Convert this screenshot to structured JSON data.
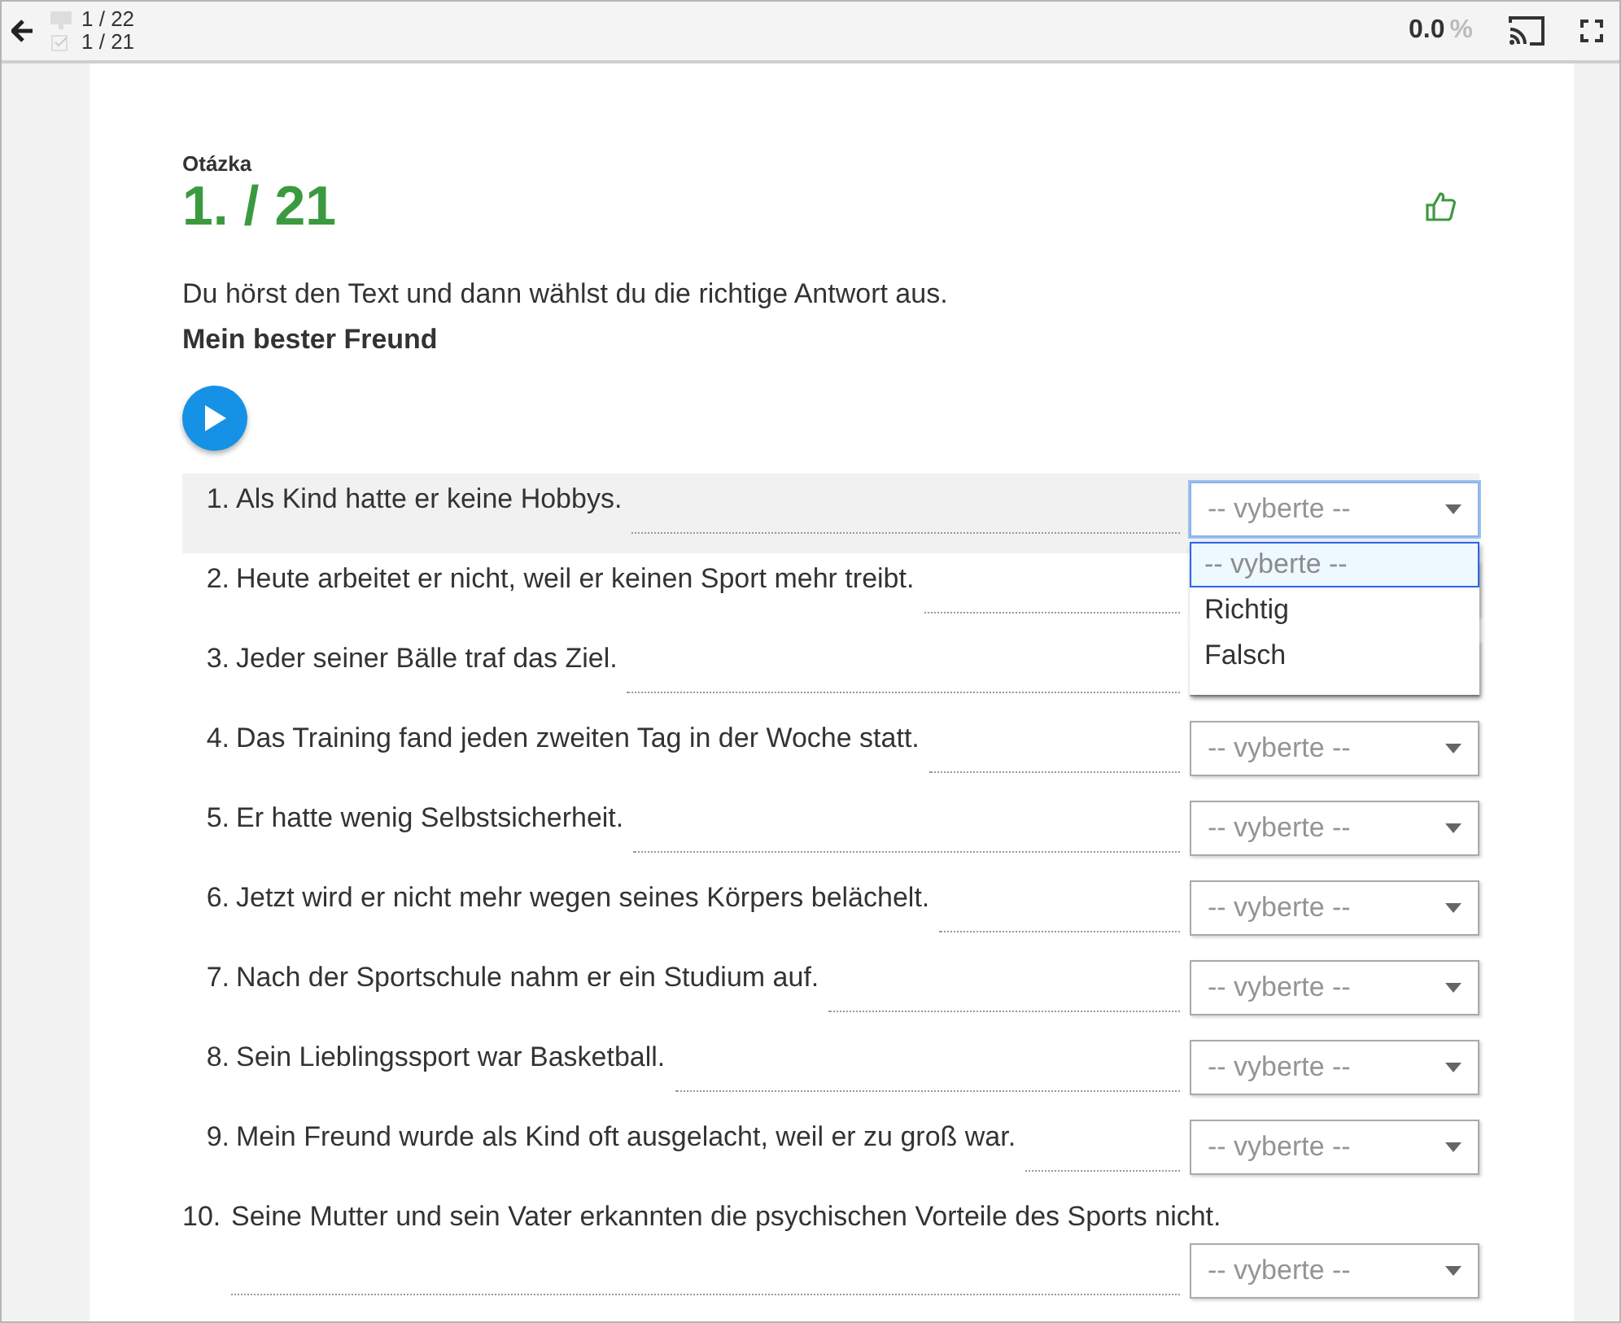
{
  "top_bar": {
    "slides": "1 / 22",
    "answered": "1 / 21",
    "score": "0.0",
    "score_unit": "%"
  },
  "question": {
    "label": "Otázka",
    "number": "1. / 21",
    "instruction": "Du hörst den Text und dann wählst du die richtige Antwort aus.",
    "title": "Mein bester Freund"
  },
  "dropdown": {
    "options": [
      {
        "label": "-- vyberte --",
        "selected": true,
        "kind": "placeholder"
      },
      {
        "label": "Richtig",
        "selected": false,
        "kind": "option"
      },
      {
        "label": "Falsch",
        "selected": false,
        "kind": "option"
      }
    ]
  },
  "statements": [
    {
      "number": "1.",
      "text": "Als Kind hatte er keine Hobbys.",
      "placeholder": "-- vyberte --",
      "expanded": true,
      "kind": "inline"
    },
    {
      "number": "2.",
      "text": "Heute arbeitet er nicht, weil er keinen Sport mehr treibt.",
      "expanded": false,
      "kind": "inline"
    },
    {
      "number": "3.",
      "text": "Jeder seiner Bälle traf das Ziel.",
      "expanded": false,
      "kind": "inline"
    },
    {
      "number": "4.",
      "text": "Das Training fand jeden zweiten Tag in der Woche statt.",
      "placeholder": "-- vyberte --",
      "expanded": false,
      "kind": "inline"
    },
    {
      "number": "5.",
      "text": "Er hatte wenig Selbstsicherheit.",
      "placeholder": "-- vyberte --",
      "expanded": false,
      "kind": "inline"
    },
    {
      "number": "6.",
      "text": "Jetzt wird er nicht mehr wegen seines Körpers belächelt.",
      "placeholder": "-- vyberte --",
      "expanded": false,
      "kind": "inline"
    },
    {
      "number": "7.",
      "text": "Nach der Sportschule nahm er ein Studium auf.",
      "placeholder": "-- vyberte --",
      "expanded": false,
      "kind": "inline"
    },
    {
      "number": "8.",
      "text": "Sein Lieblingssport war Basketball.",
      "placeholder": "-- vyberte --",
      "expanded": false,
      "kind": "inline"
    },
    {
      "number": "9.",
      "text": "Mein Freund wurde als Kind oft ausgelacht, weil er zu groß war.",
      "placeholder": "-- vyberte --",
      "expanded": false,
      "kind": "inline"
    },
    {
      "number": "10.",
      "text": "Seine Mutter und sein Vater erkannten die psychischen Vorteile des Sports nicht.",
      "placeholder": "-- vyberte --",
      "expanded": false,
      "kind": "wrapped"
    }
  ]
}
